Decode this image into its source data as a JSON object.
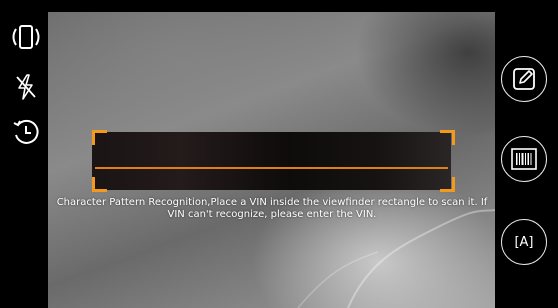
{
  "scanner": {
    "hint": "Character Pattern Recognition,Place a VIN inside the viewfinder rectangle to scan it. If VIN can't recognize, please enter the VIN.",
    "accent_color": "#f39a1d"
  },
  "left_toolbar": {
    "icons": [
      "rotate-orientation-icon",
      "flash-off-icon",
      "history-icon"
    ]
  },
  "right_toolbar": {
    "buttons": [
      "edit-icon",
      "barcode-icon",
      "text-recognition-icon"
    ],
    "ocr_label": "[A]"
  }
}
